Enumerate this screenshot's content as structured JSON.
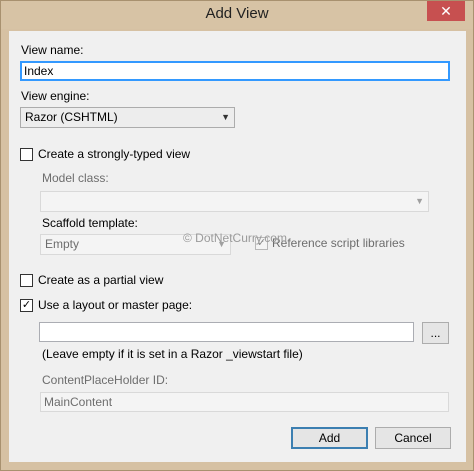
{
  "window": {
    "title": "Add View",
    "close_glyph": "✕"
  },
  "view_name": {
    "label": "View name:",
    "value": "Index"
  },
  "view_engine": {
    "label": "View engine:",
    "selected": "Razor (CSHTML)"
  },
  "strongly_typed": {
    "label": "Create a strongly-typed view",
    "checked": false
  },
  "model_class": {
    "label": "Model class:",
    "value": ""
  },
  "scaffold": {
    "label": "Scaffold template:",
    "selected": "Empty",
    "reference_scripts_label": "Reference script libraries",
    "reference_scripts_checked": true
  },
  "partial_view": {
    "label": "Create as a partial view",
    "checked": false
  },
  "layout": {
    "label": "Use a layout or master page:",
    "checked": true,
    "value": "",
    "browse_label": "...",
    "hint": "(Leave empty if it is set in a Razor _viewstart file)"
  },
  "content_placeholder": {
    "label": "ContentPlaceHolder ID:",
    "value": "MainContent"
  },
  "buttons": {
    "add": "Add",
    "cancel": "Cancel"
  },
  "watermark": "© DotNetCurry.com",
  "icons": {
    "checkmark": "✓",
    "dropdown": "▼"
  }
}
